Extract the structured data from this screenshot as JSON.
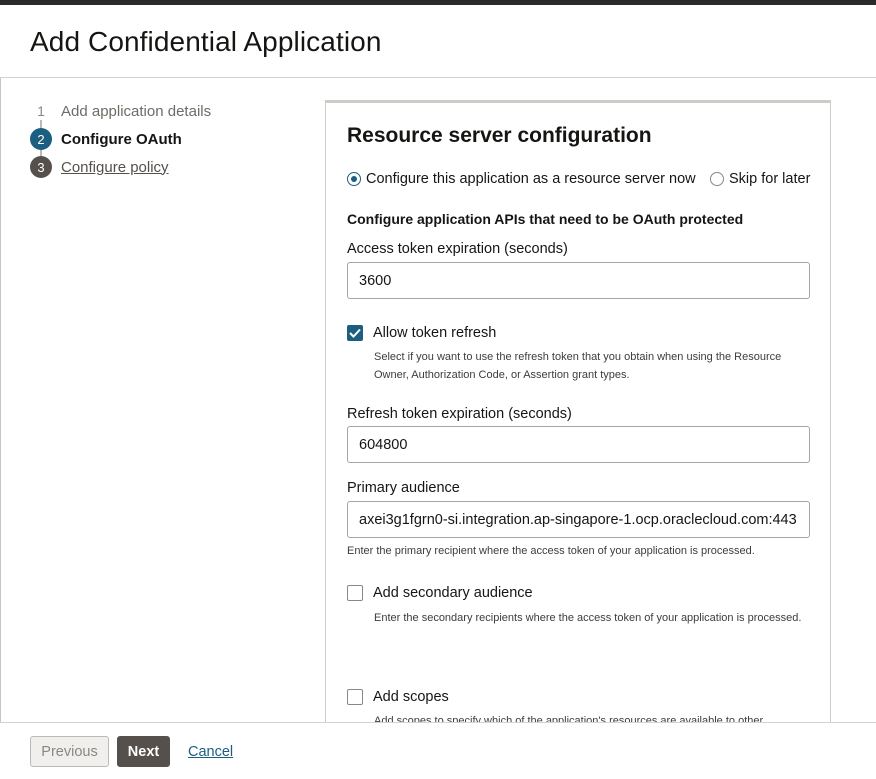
{
  "page": {
    "title": "Add Confidential Application"
  },
  "stepper": {
    "steps": [
      {
        "number": "1",
        "label": "Add application details",
        "state": "completed"
      },
      {
        "number": "2",
        "label": "Configure OAuth",
        "state": "current"
      },
      {
        "number": "3",
        "label": "Configure policy",
        "state": "upcoming"
      }
    ]
  },
  "resource_server": {
    "title": "Resource server configuration",
    "radio_options": [
      {
        "label": "Configure this application as a resource server now",
        "selected": true
      },
      {
        "label": "Skip for later",
        "selected": false
      }
    ],
    "section_heading": "Configure application APIs that need to be OAuth protected",
    "access_token_expiration": {
      "label": "Access token expiration (seconds)",
      "value": "3600"
    },
    "allow_token_refresh": {
      "label": "Allow token refresh",
      "checked": true,
      "help": "Select if you want to use the refresh token that you obtain when using the Resource Owner, Authorization Code, or Assertion grant types."
    },
    "refresh_token_expiration": {
      "label": "Refresh token expiration (seconds)",
      "value": "604800"
    },
    "primary_audience": {
      "label": "Primary audience",
      "value": "axei3g1fgrn0-si.integration.ap-singapore-1.ocp.oraclecloud.com:443",
      "help": "Enter the primary recipient where the access token of your application is processed."
    },
    "secondary_audience": {
      "label": "Add secondary audience",
      "checked": false,
      "help": "Enter the secondary recipients where the access token of your application is processed."
    },
    "scopes": {
      "label": "Add scopes",
      "checked": false,
      "help": "Add scopes to specify which of the application's resources are available to other"
    }
  },
  "footer": {
    "previous_label": "Previous",
    "next_label": "Next",
    "cancel_label": "Cancel"
  },
  "colors": {
    "accent": "#1c5e80",
    "primary_button": "#55504b",
    "text": "#161513"
  }
}
